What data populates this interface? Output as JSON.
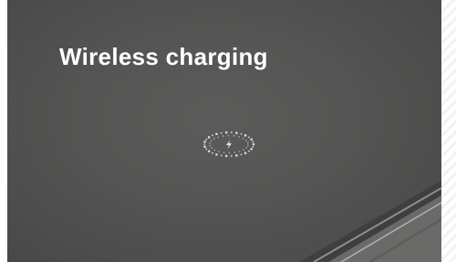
{
  "title": "Wireless charging",
  "icons": {
    "charging_indicator": "charging-ring-icon",
    "bolt": "lightning-bolt-icon"
  },
  "colors": {
    "surface": "#545453",
    "title": "#ffffff",
    "indicator": "#d8d8d8",
    "edge_highlight": "#9a9a9a"
  }
}
